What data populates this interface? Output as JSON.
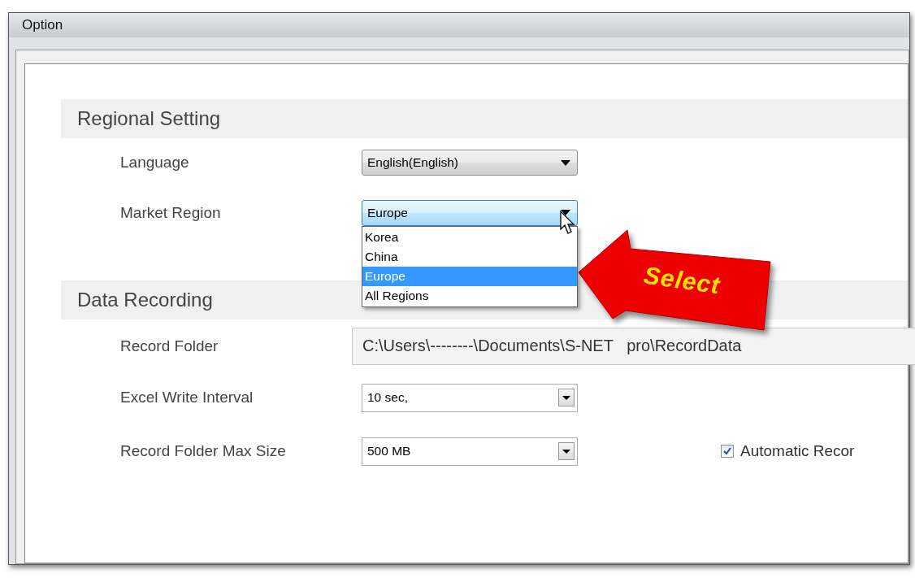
{
  "window": {
    "title": "Option"
  },
  "sections": [
    {
      "title": "Regional Setting",
      "rows": [
        {
          "kind": "aero_combo",
          "label": "Language",
          "value": "English(English)",
          "open": false
        },
        {
          "kind": "aero_combo",
          "label": "Market Region",
          "value": "Europe",
          "open": true,
          "options": [
            {
              "label": "Korea",
              "selected": false
            },
            {
              "label": "China",
              "selected": false
            },
            {
              "label": "Europe",
              "selected": true
            },
            {
              "label": "All Regions",
              "selected": false
            }
          ]
        }
      ]
    },
    {
      "title": "Data Recording",
      "rows": [
        {
          "kind": "text_field",
          "label": "Record Folder",
          "value": "C:\\Users\\--------\\Documents\\S-NET   pro\\RecordData"
        },
        {
          "kind": "classic_combo",
          "label": "Excel Write Interval",
          "value": "10 sec,"
        },
        {
          "kind": "classic_combo",
          "label": "Record Folder Max Size",
          "value": "500 MB",
          "checkbox": {
            "label": "Automatic Recor",
            "checked": true
          }
        }
      ]
    }
  ],
  "callout": {
    "text": "Select"
  }
}
